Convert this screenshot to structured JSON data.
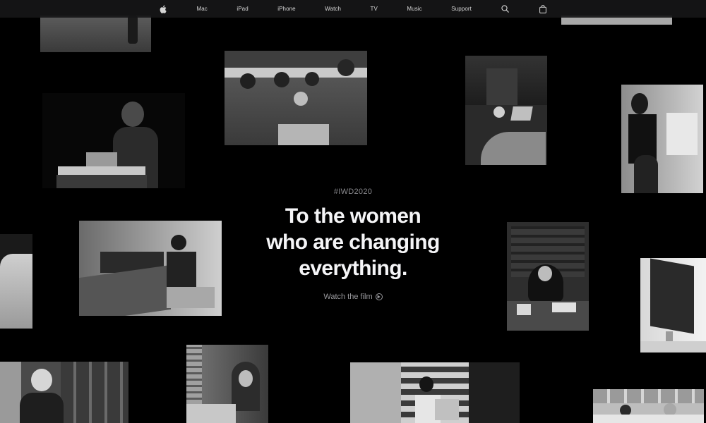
{
  "nav": {
    "items": [
      "Mac",
      "iPad",
      "iPhone",
      "Watch",
      "TV",
      "Music",
      "Support"
    ],
    "icons": [
      "apple-logo-icon",
      "search-icon",
      "bag-icon"
    ]
  },
  "hero": {
    "tag": "#IWD2020",
    "headline": [
      "To the women",
      "who are changing",
      "everything."
    ],
    "cta": "Watch the film"
  },
  "colors": {
    "background": "#000000",
    "nav_background": "#161617",
    "headline": "#f5f5f7",
    "muted": "#8a8a8e"
  }
}
